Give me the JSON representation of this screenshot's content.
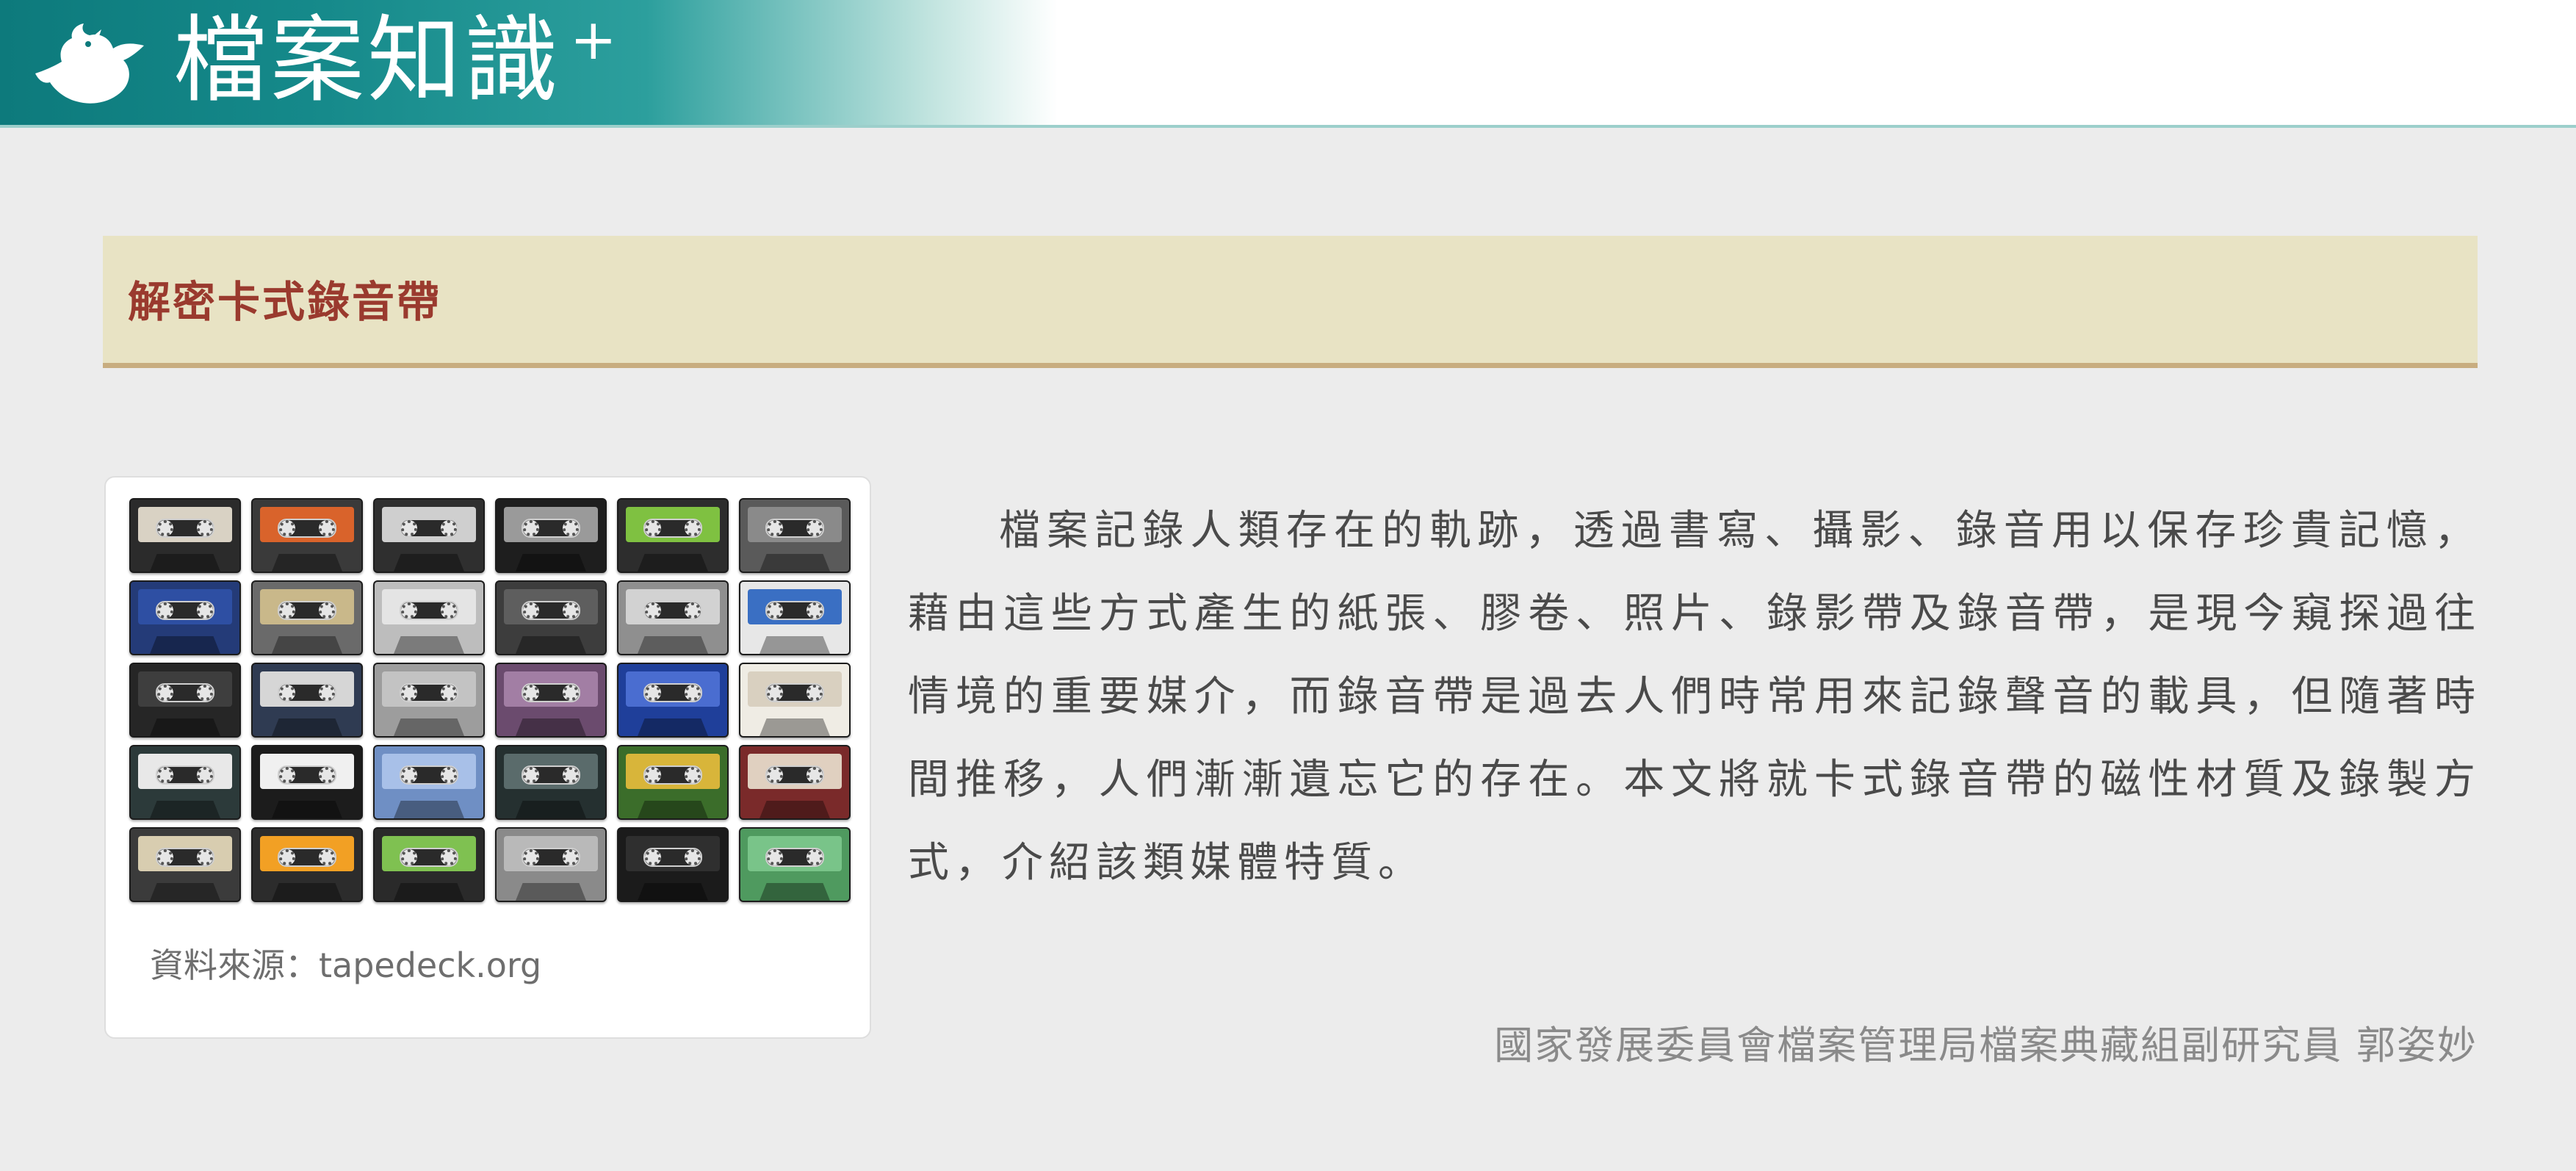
{
  "header": {
    "site_title": "檔案知識",
    "site_title_plus": "+",
    "logo_icon": "bird-icon",
    "accent_color": "#0d7a7c"
  },
  "section": {
    "title": "解密卡式錄音帶",
    "banner_color": "#e8e3c4",
    "title_color": "#9a3a2e"
  },
  "figure": {
    "image_description": "cassette-tapes-collage",
    "credit": "資料來源：tapedeck.org",
    "tapes": [
      {
        "color": "#2b2b2b",
        "label": "#d9d2c4"
      },
      {
        "color": "#3a3a3a",
        "label": "#d9632b"
      },
      {
        "color": "#2f2f2f",
        "label": "#cfcfcf"
      },
      {
        "color": "#1e1e1e",
        "label": "#9a9a9a"
      },
      {
        "color": "#2d2d2d",
        "label": "#7fc141"
      },
      {
        "color": "#5a5a5a",
        "label": "#8a8a8a"
      },
      {
        "color": "#243b78",
        "label": "#2e4fa3"
      },
      {
        "color": "#6a6a6a",
        "label": "#c9b88a"
      },
      {
        "color": "#bdbdbd",
        "label": "#e4e4e4"
      },
      {
        "color": "#3d3d3d",
        "label": "#5e5e5e"
      },
      {
        "color": "#8f8f8f",
        "label": "#d2d2d2"
      },
      {
        "color": "#e7e7e7",
        "label": "#3a6fc3"
      },
      {
        "color": "#262626",
        "label": "#3e3e3e"
      },
      {
        "color": "#2f3b52",
        "label": "#d6d6d6"
      },
      {
        "color": "#9d9d9d",
        "label": "#c3c3c3"
      },
      {
        "color": "#6b4b6e",
        "label": "#a27ea4"
      },
      {
        "color": "#1f3f9a",
        "label": "#4a6dd0"
      },
      {
        "color": "#efece4",
        "label": "#d9d0c0"
      },
      {
        "color": "#2c3a3a",
        "label": "#e8e8e8"
      },
      {
        "color": "#1c1c1c",
        "label": "#f0f0f0"
      },
      {
        "color": "#6f8fc4",
        "label": "#a8c0e8"
      },
      {
        "color": "#253030",
        "label": "#5a6b6b"
      },
      {
        "color": "#3b6d2a",
        "label": "#d8b53a"
      },
      {
        "color": "#7a2a2a",
        "label": "#e0d0c0"
      },
      {
        "color": "#3b3b3b",
        "label": "#d8cdb0"
      },
      {
        "color": "#2c2c2c",
        "label": "#f2a024"
      },
      {
        "color": "#2a2a2a",
        "label": "#7fc151"
      },
      {
        "color": "#8a8a8a",
        "label": "#b9b9b9"
      },
      {
        "color": "#1b1b1b",
        "label": "#2f2f2f"
      },
      {
        "color": "#4f9a5f",
        "label": "#79c489"
      }
    ]
  },
  "article": {
    "body": "檔案記錄人類存在的軌跡，透過書寫、攝影、錄音用以保存珍貴記憶，藉由這些方式產生的紙張、膠卷、照片、錄影帶及錄音帶，是現今窺探過往情境的重要媒介，而錄音帶是過去人們時常用來記錄聲音的載具，但隨著時間推移，人們漸漸遺忘它的存在。本文將就卡式錄音帶的磁性材質及錄製方式，介紹該類媒體特質。",
    "author": "國家發展委員會檔案管理局檔案典藏組副研究員 郭姿妙"
  }
}
